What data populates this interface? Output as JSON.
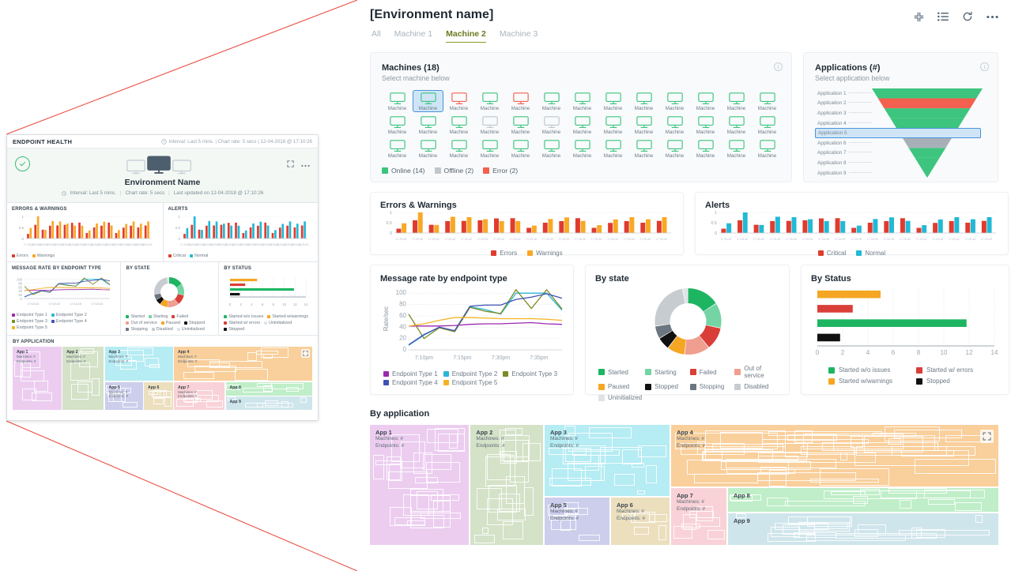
{
  "header": {
    "title": "[Environment name]",
    "icons": [
      {
        "name": "collapse-icon",
        "label": "Collapse"
      },
      {
        "name": "list-view-icon",
        "label": "List view"
      },
      {
        "name": "refresh-icon",
        "label": "Refresh"
      },
      {
        "name": "more-options-icon",
        "label": "More options"
      }
    ]
  },
  "tabs": [
    {
      "label": "All",
      "active": false
    },
    {
      "label": "Machine 1",
      "active": false
    },
    {
      "label": "Machine 2",
      "active": true
    },
    {
      "label": "Machine 3",
      "active": false
    }
  ],
  "machines_card": {
    "title": "Machines (18)",
    "subtitle": "Select machine below",
    "machine_label": "Machine",
    "info_icon": "info-icon",
    "columns": 13,
    "rows": 3,
    "statuses": [
      "online",
      "selected",
      "error",
      "online",
      "error",
      "online",
      "online",
      "online",
      "online",
      "online",
      "online",
      "online",
      "online",
      "online",
      "online",
      "online",
      "offline",
      "online",
      "offline",
      "online",
      "online",
      "online",
      "online",
      "online",
      "online",
      "online",
      "online",
      "online",
      "online",
      "online",
      "online",
      "online",
      "online",
      "online",
      "online",
      "online",
      "online",
      "online",
      "online"
    ],
    "legend": [
      {
        "label": "Online (14)",
        "color": "#3dc47e"
      },
      {
        "label": "Offline (2)",
        "color": "#bfc6cc"
      },
      {
        "label": "Error (2)",
        "color": "#f4604f"
      }
    ]
  },
  "applications_card": {
    "title": "Applications (#)",
    "subtitle": "Select application below",
    "info_icon": "info-icon",
    "items": [
      {
        "label": "Application 1",
        "color": "#3dc47e",
        "selected": false
      },
      {
        "label": "Application 2",
        "color": "#f4604f",
        "selected": false
      },
      {
        "label": "Application 3",
        "color": "#3dc47e",
        "selected": false
      },
      {
        "label": "Application 4",
        "color": "#3dc47e",
        "selected": false
      },
      {
        "label": "Application 5",
        "color": "#3dc47e",
        "selected": true
      },
      {
        "label": "Application 6",
        "color": "#a8b0b7",
        "selected": false
      },
      {
        "label": "Application 7",
        "color": "#3dc47e",
        "selected": false
      },
      {
        "label": "Application 8",
        "color": "#3dc47e",
        "selected": false
      },
      {
        "label": "Application 9",
        "color": "#3dc47e",
        "selected": false
      }
    ]
  },
  "chart_data": [
    {
      "id": "errors_warnings",
      "type": "bar",
      "title": "Errors & Warnings",
      "xlabel": "",
      "ylabel": "",
      "ylim": [
        0,
        1
      ],
      "yticks": [
        0,
        0.5,
        1
      ],
      "grid": true,
      "legend_position": "bottom",
      "categories": [
        "17:25:45",
        "17:25:45",
        "17:25:45",
        "17:25:45",
        "17:25:45",
        "17:25:45",
        "17:25:45",
        "17:25:45",
        "17:25:45",
        "17:25:45",
        "17:25:45",
        "17:25:45",
        "17:25:45",
        "17:25:45",
        "17:25:45",
        "17:25:45",
        "17:25:45"
      ],
      "series": [
        {
          "name": "Errors",
          "color": "#e03b2f",
          "values": [
            0.21,
            0.62,
            0.4,
            0.58,
            0.59,
            0.62,
            0.71,
            0.72,
            0.25,
            0.5,
            0.58,
            0.72,
            0.25,
            0.49,
            0.58,
            0.5,
            0.59
          ]
        },
        {
          "name": "Warnings",
          "color": "#f9a825",
          "values": [
            0.47,
            1.0,
            0.39,
            0.79,
            0.77,
            0.67,
            0.58,
            0.58,
            0.36,
            0.68,
            0.76,
            0.59,
            0.38,
            0.66,
            0.77,
            0.67,
            0.77
          ]
        }
      ]
    },
    {
      "id": "alerts",
      "type": "bar",
      "title": "Alerts",
      "xlabel": "",
      "ylabel": "",
      "ylim": [
        0,
        1
      ],
      "yticks": [
        0,
        0.5,
        1
      ],
      "grid": true,
      "legend_position": "bottom",
      "categories": [
        "17:25:45",
        "17:25:45",
        "17:25:45",
        "17:25:45",
        "17:25:45",
        "17:25:45",
        "17:25:45",
        "17:25:45",
        "17:25:45",
        "17:25:45",
        "17:25:45",
        "17:25:45",
        "17:25:45",
        "17:25:45",
        "17:25:45",
        "17:25:45",
        "17:25:45"
      ],
      "series": [
        {
          "name": "Critical",
          "color": "#e03b2f",
          "values": [
            0.21,
            0.62,
            0.4,
            0.58,
            0.59,
            0.62,
            0.71,
            0.72,
            0.25,
            0.5,
            0.58,
            0.72,
            0.25,
            0.49,
            0.58,
            0.5,
            0.59
          ]
        },
        {
          "name": "Normal",
          "color": "#21b9d6",
          "values": [
            0.47,
            1.0,
            0.39,
            0.79,
            0.77,
            0.67,
            0.58,
            0.58,
            0.36,
            0.68,
            0.76,
            0.59,
            0.38,
            0.66,
            0.77,
            0.67,
            0.77
          ]
        }
      ]
    },
    {
      "id": "message_rate",
      "type": "line",
      "title": "Message rate by endpoint type",
      "xlabel": "",
      "ylabel": "Rate/sec",
      "ylim": [
        0,
        100
      ],
      "yticks": [
        0,
        20,
        40,
        60,
        80,
        100
      ],
      "xticks": [
        "7:10pm",
        "7:15pm",
        "7:30pm",
        "7:35pm"
      ],
      "grid": true,
      "legend_position": "bottom",
      "x": [
        0,
        1,
        2,
        3,
        4,
        5,
        6,
        7,
        8,
        9,
        10
      ],
      "series": [
        {
          "name": "Endpoint Type 1",
          "color": "#9c27b0",
          "values": [
            42,
            42,
            42,
            43,
            45,
            46,
            46,
            47,
            48,
            46,
            45
          ]
        },
        {
          "name": "Endpoint Type 2",
          "color": "#29b6d8",
          "values": [
            8,
            26,
            40,
            33,
            76,
            71,
            63,
            100,
            100,
            100,
            70
          ]
        },
        {
          "name": "Endpoint Type 3",
          "color": "#7a8b22",
          "values": [
            63,
            20,
            39,
            32,
            75,
            68,
            64,
            106,
            73,
            106,
            72
          ]
        },
        {
          "name": "Endpoint Type 4",
          "color": "#3f51b5",
          "values": [
            9,
            27,
            40,
            34,
            77,
            79,
            79,
            89,
            93,
            99,
            91
          ]
        },
        {
          "name": "Endpoint Type 5",
          "color": "#f5b323",
          "values": [
            42,
            46,
            52,
            57,
            57,
            56,
            55,
            55,
            55,
            54,
            52
          ]
        }
      ]
    },
    {
      "id": "by_state",
      "type": "pie",
      "title": "By state",
      "donut": true,
      "legend_position": "bottom",
      "labels": [
        "Started",
        "Starting",
        "Failed",
        "Out of service",
        "Paused",
        "Stopped",
        "Stopping",
        "Disabled",
        "Uninitialized"
      ],
      "values": [
        13,
        10,
        9,
        10,
        7,
        5,
        5,
        20,
        2
      ],
      "colors": [
        "#1eb562",
        "#74d4a4",
        "#d93f38",
        "#ef9e8f",
        "#f5a623",
        "#111111",
        "#6b7680",
        "#c7ccd1",
        "#dfe3e6"
      ]
    },
    {
      "id": "by_status",
      "type": "bar",
      "orientation": "horizontal",
      "title": "By Status",
      "xlim": [
        0,
        14
      ],
      "xticks": [
        0,
        2,
        4,
        6,
        8,
        10,
        12,
        14
      ],
      "grid": true,
      "legend_position": "bottom",
      "categories": [
        "Started w/warnings",
        "Started w/ errors",
        "Started w/o issues",
        "Stopped"
      ],
      "values": [
        5.0,
        2.8,
        11.8,
        1.8
      ],
      "colors": [
        "#f5a623",
        "#d93f38",
        "#1eb562",
        "#111111"
      ],
      "legend": [
        {
          "label": "Started w/o issues",
          "color": "#1eb562"
        },
        {
          "label": "Started w/ errors",
          "color": "#d93f38"
        },
        {
          "label": "Started w/warnings",
          "color": "#f5a623"
        },
        {
          "label": "Stopped",
          "color": "#111111"
        }
      ]
    },
    {
      "id": "by_application",
      "type": "treemap",
      "title": "By application",
      "tiles": [
        {
          "name": "App 1",
          "machines": "Machines: #",
          "endpoints": "Endpoints: #",
          "color": "#eccdf0"
        },
        {
          "name": "App 2",
          "machines": "Machines: #",
          "endpoints": "Endpoints: #",
          "color": "#d4e2c8"
        },
        {
          "name": "App 3",
          "machines": "Machines: #",
          "endpoints": "Endpoints: #",
          "color": "#b6ecf3"
        },
        {
          "name": "App 4",
          "machines": "Machines: #",
          "endpoints": "Endpoints: #",
          "color": "#f9cf9b"
        },
        {
          "name": "App 5",
          "machines": "Machines: #",
          "endpoints": "Endpoints: #",
          "color": "#ccceec"
        },
        {
          "name": "App 6",
          "machines": "Machines: #",
          "endpoints": "Endpoints: #",
          "color": "#ecdfbe"
        },
        {
          "name": "App 7",
          "machines": "Machines: #",
          "endpoints": "Endpoints: #",
          "color": "#f9d2d7"
        },
        {
          "name": "App 8",
          "machines": "",
          "endpoints": "",
          "color": "#bfeec8"
        },
        {
          "name": "App 9",
          "machines": "",
          "endpoints": "",
          "color": "#cfe5ec"
        }
      ],
      "expand_icon": "expand-icon"
    }
  ],
  "mini_panel": {
    "header_title": "ENDPOINT HEALTH",
    "header_meta": "Interval: Last 5 mins.  |  Chart rate: 5 secs  |  12-04-2018 @ 17:10:26",
    "clock_icon": "clock-icon",
    "status_icon": "check-circle-icon",
    "env_name": "Environment Name",
    "sub_interval": "Interval: Last 5 mins.",
    "sub_rate": "Chart rate: 5 secs",
    "sub_updated": "Last updated on 12-04-2018 @ 17:10:26",
    "expand_icon": "expand-icon",
    "more_icon": "more-options-icon",
    "sections": {
      "errors_warnings": "ERRORS & WARNINGS",
      "alerts": "ALERTS",
      "message_rate": "MESSAGE RATE BY ENDPOINT TYPE",
      "by_state": "BY STATE",
      "by_status": "BY STATUS",
      "by_application": "BY APPLICATION"
    },
    "status_legend": [
      {
        "label": "Started w/o issues",
        "color": "#1eb562"
      },
      {
        "label": "Started w/warnings",
        "color": "#f5a623"
      },
      {
        "label": "Started w/ errors",
        "color": "#d93f38"
      },
      {
        "label": "Uninitialized",
        "color": "#dfe3e6"
      },
      {
        "label": "Stopped",
        "color": "#111111"
      }
    ]
  }
}
